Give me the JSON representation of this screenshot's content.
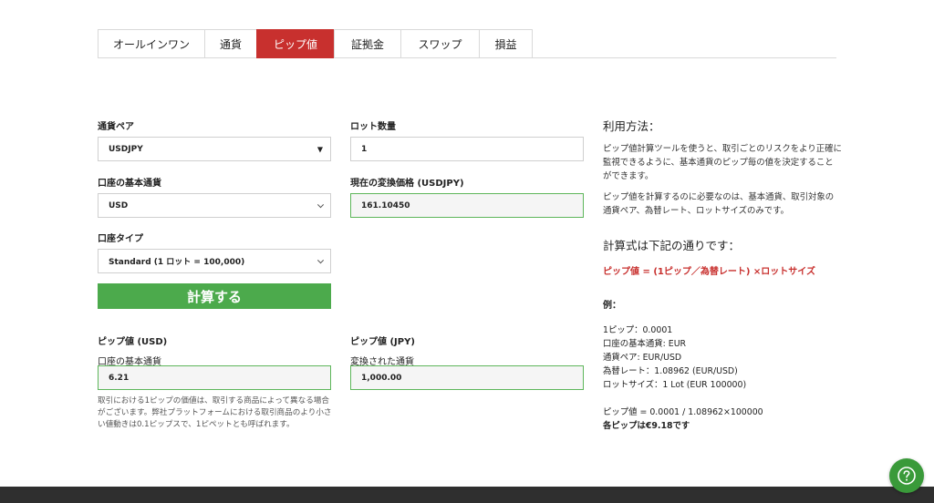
{
  "tabs": [
    {
      "label": "オールインワン",
      "active": false
    },
    {
      "label": "通貨",
      "active": false
    },
    {
      "label": "ピップ値",
      "active": true
    },
    {
      "label": "証拠金",
      "active": false
    },
    {
      "label": "スワップ",
      "active": false
    },
    {
      "label": "損益",
      "active": false
    }
  ],
  "form": {
    "currency_pair_label": "通貨ペア",
    "currency_pair_value": "USDJPY",
    "lot_label": "ロット数量",
    "lot_value": "1",
    "base_currency_label": "口座の基本通貨",
    "base_currency_value": "USD",
    "rate_label": "現在の変換価格 (USDJPY)",
    "rate_value": "161.10450",
    "account_type_label": "口座タイプ",
    "account_type_value": "Standard (1 ロット = 100,000)",
    "calculate_label": "計算する"
  },
  "results": {
    "usd_title": "ピップ値 (USD)",
    "usd_sublabel": "口座の基本通貨",
    "usd_value": "6.21",
    "jpy_title": "ピップ値 (JPY)",
    "jpy_sublabel": "変換された通貨",
    "jpy_value": "1,000.00",
    "note": "取引における1ピップの価値は、取引する商品によって異なる場合がございます。弊社プラットフォームにおける取引商品のより小さい値動きは0.1ピップスで、1ピペットとも呼ばれます。"
  },
  "info": {
    "usage_title": "利用方法：",
    "usage_p1": "ピップ値計算ツールを使うと、取引ごとのリスクをより正確に監視できるように、基本通貨のピップ毎の値を決定することができます。",
    "usage_p2": "ピップ値を計算するのに必要なのは、基本通貨、取引対象の通貨ペア、為替レート、ロットサイズのみです。",
    "formula_title": "計算式は下記の通りです：",
    "formula": "ピップ値 = (1ピップ／為替レート) ×ロットサイズ",
    "example_label": "例：",
    "example_lines": [
      "1ピップ：0.0001",
      "口座の基本通貨: EUR",
      "通貨ペア: EUR/USD",
      "為替レート：1.08962 (EUR/USD)",
      "ロットサイズ：1 Lot (EUR 100000)"
    ],
    "example_calc": "ピップ値 = 0.0001 / 1.08962×100000",
    "example_result": "各ピップは€9.18です"
  },
  "colors": {
    "accent_red": "#c8302e",
    "button_green": "#4caa4c",
    "field_border_green": "#5db65a"
  },
  "icons": {
    "help": "question-circle-icon"
  }
}
